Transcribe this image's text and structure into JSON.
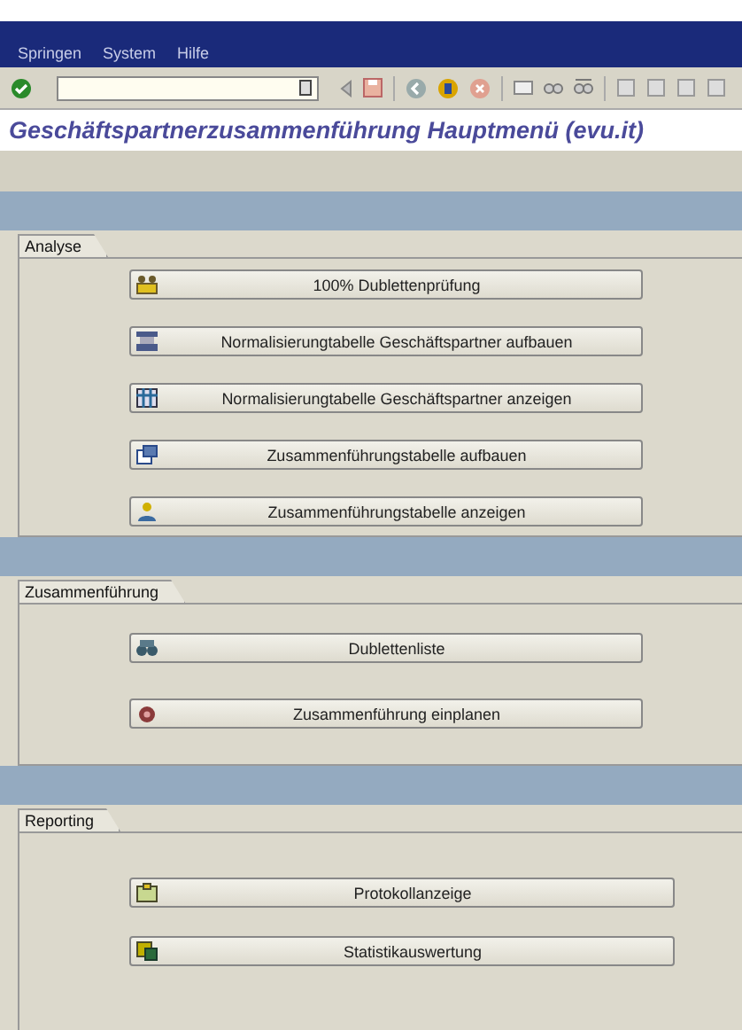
{
  "menu_bar": {
    "items": [
      "Springen",
      "System",
      "Hilfe"
    ]
  },
  "title": "Geschäftspartnerzusammenführung Hauptmenü (evu.it)",
  "sections": [
    {
      "title": "Analyse",
      "buttons": [
        "100% Dublettenprüfung",
        "Normalisierungtabelle Geschäftspartner aufbauen",
        "Normalisierungtabelle Geschäftspartner anzeigen",
        "Zusammenführungstabelle aufbauen",
        "Zusammenführungstabelle anzeigen"
      ]
    },
    {
      "title": "Zusammenführung",
      "buttons": [
        "Dublettenliste",
        "Zusammenführung einplanen"
      ]
    },
    {
      "title": "Reporting",
      "buttons": [
        "Protokollanzeige",
        "Statistikauswertung"
      ]
    }
  ]
}
